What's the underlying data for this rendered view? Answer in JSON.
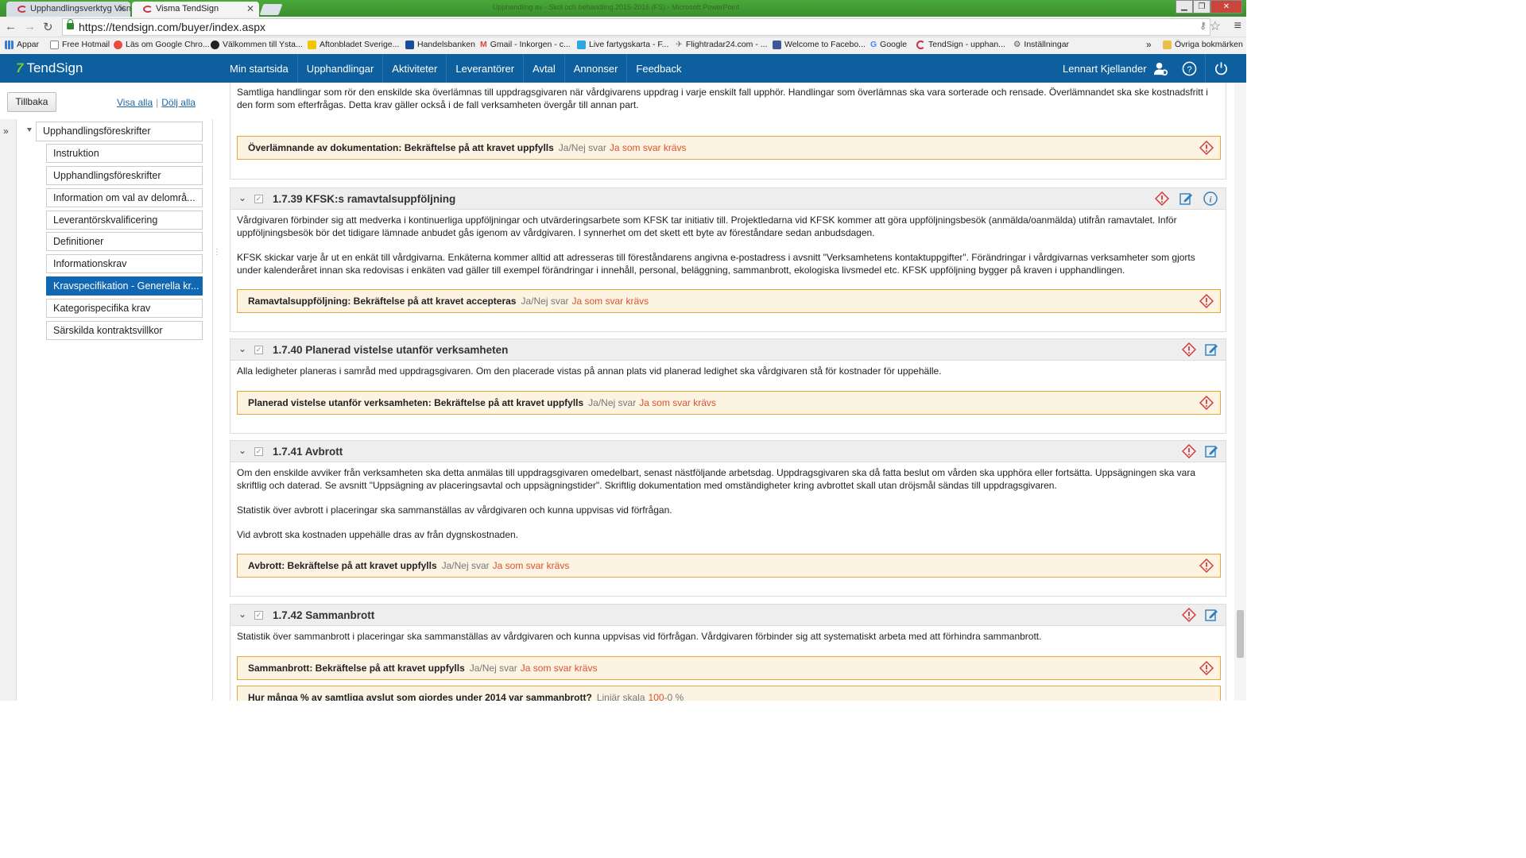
{
  "browser": {
    "tabs": [
      {
        "title": "Upphandlingsverktyg Visn",
        "active": false
      },
      {
        "title": "Visma TendSign",
        "active": true
      }
    ],
    "window_title": "Upphandling av - Skol och behandling 2015-2016 (FS) - Microsoft PowerPoint",
    "url": "https://tendsign.com/buyer/index.aspx",
    "bookmarks": [
      "Appar",
      "Free Hotmail",
      "Läs om Google Chro...",
      "Välkommen till Ysta...",
      "Aftonbladet Sverige...",
      "Handelsbanken",
      "Gmail - Inkorgen - c...",
      "Live fartygskarta - F...",
      "Flightradar24.com - ...",
      "Welcome to Facebo...",
      "Google",
      "TendSign - upphan...",
      "Inställningar"
    ],
    "bookmarks_more": "»",
    "other_bookmarks": "Övriga bokmärken"
  },
  "app": {
    "logo_mark": "7",
    "logo_text": "TendSign",
    "nav": [
      "Min startsida",
      "Upphandlingar",
      "Aktiviteter",
      "Leverantörer",
      "Avtal",
      "Annonser",
      "Feedback"
    ],
    "user": "Lennart Kjellander",
    "accent": "#0d5f9e"
  },
  "left": {
    "back": "Tillbaka",
    "show_all": "Visa alla",
    "separator": "|",
    "hide_all": "Dölj alla",
    "root": "Upphandlingsföreskrifter",
    "items": [
      "Instruktion",
      "Upphandlingsföreskrifter",
      "Information om val av delområ...",
      "Leverantörskvalificering",
      "Definitioner",
      "Informationskrav",
      "Kravspecifikation - Generella kr...",
      "Kategorispecifika krav",
      "Särskilda kontraktsvillkor"
    ],
    "active_index": 6
  },
  "content": {
    "top_partial": {
      "text": "Samtliga handlingar som rör den enskilde ska överlämnas till uppdragsgivaren när vårdgivarens uppdrag i varje enskilt fall upphör. Handlingar som överlämnas ska vara sorterade och rensade. Överlämnandet ska ske kostnadsfritt i den form som efterfrågas. Detta krav gäller också i de fall verksamheten övergår till annan part.",
      "req_label": "Överlämnande av dokumentation: Bekräftelse på att kravet uppfylls",
      "req_type": "Ja/Nej svar",
      "req_value": "Ja som svar krävs"
    },
    "sections": [
      {
        "title": "1.7.39 KFSK:s ramavtalsuppföljning",
        "paragraphs": [
          "Vårdgivaren förbinder sig att medverka i kontinuerliga uppföljningar och utvärderingsarbete som KFSK tar initiativ till. Projektledarna vid KFSK kommer att göra uppföljningsbesök (anmälda/oanmälda) utifrån ramavtalet. Inför uppföljningsbesök bör det tidigare lämnade anbudet gås igenom av vårdgivaren. I synnerhet om det skett ett byte av föreståndare sedan anbudsdagen.",
          "KFSK skickar varje år ut en enkät till vårdgivarna. Enkäterna kommer alltid att adresseras till föreståndarens angivna e-postadress i avsnitt \"Verksamhetens kontaktuppgifter\". Förändringar i vårdgivarnas verksamheter som gjorts under kalenderåret innan ska redovisas i enkäten vad gäller till exempel förändringar i innehåll, personal, beläggning, sammanbrott, ekologiska livsmedel etc. KFSK uppföljning bygger på kraven i upphandlingen."
        ],
        "req_label": "Ramavtalsuppföljning: Bekräftelse på att kravet accepteras",
        "req_type": "Ja/Nej svar",
        "req_value": "Ja som svar krävs"
      },
      {
        "title": "1.7.40 Planerad vistelse utanför verksamheten",
        "paragraphs": [
          "Alla ledigheter planeras i samråd med uppdragsgivaren. Om den placerade vistas på annan plats vid planerad ledighet ska vårdgivaren stå för kostnader för uppehälle."
        ],
        "req_label": "Planerad vistelse utanför verksamheten: Bekräftelse på att kravet uppfylls",
        "req_type": "Ja/Nej svar",
        "req_value": "Ja som svar krävs"
      },
      {
        "title": "1.7.41 Avbrott",
        "paragraphs": [
          "Om den enskilde avviker från verksamheten ska detta anmälas till uppdragsgivaren omedelbart, senast nästföljande arbetsdag. Uppdragsgivaren ska då fatta beslut om vården ska upphöra eller fortsätta. Uppsägningen ska vara skriftlig och daterad. Se avsnitt \"Uppsägning av placeringsavtal och uppsägningstider\". Skriftlig dokumentation med omständigheter kring avbrottet skall utan dröjsmål sändas till uppdragsgivaren.",
          "Statistik över avbrott i placeringar ska sammanställas av vårdgivaren och kunna uppvisas vid förfrågan.",
          "Vid avbrott ska kostnaden uppehälle dras av från dygnskostnaden."
        ],
        "req_label": "Avbrott: Bekräftelse på att kravet uppfylls",
        "req_type": "Ja/Nej svar",
        "req_value": "Ja som svar krävs"
      },
      {
        "title": "1.7.42 Sammanbrott",
        "paragraphs": [
          "Statistik över sammanbrott i placeringar ska sammanställas av vårdgivaren och kunna uppvisas vid förfrågan. Vårdgivaren förbinder sig att systematiskt arbeta med att förhindra sammanbrott."
        ],
        "req_label": "Sammanbrott: Bekräftelse på att kravet uppfylls",
        "req_type": "Ja/Nej svar",
        "req_value": "Ja som svar krävs",
        "req2_label": "Hur många % av samtliga avslut som gjordes under 2014 var sammanbrott?",
        "req2_type": "Linjär skala",
        "req2_value_a": "100",
        "req2_value_sep": "-",
        "req2_value_b": "0 %"
      }
    ]
  },
  "icons": {
    "back": "back-arrow-icon",
    "forward": "forward-arrow-icon",
    "reload": "reload-icon",
    "warning": "warning-icon",
    "edit": "edit-icon",
    "info": "info-icon",
    "user_settings": "user-settings-icon",
    "help": "help-icon",
    "power": "power-icon",
    "expand_rail": "double-chevron-right-icon"
  },
  "colors": {
    "header_blue": "#0d5f9e",
    "active_item": "#1167b1",
    "req_border": "#e8a53a",
    "req_bg": "#fdf3e3",
    "required_red": "#d9532b",
    "warning_red": "#d23a3a"
  }
}
